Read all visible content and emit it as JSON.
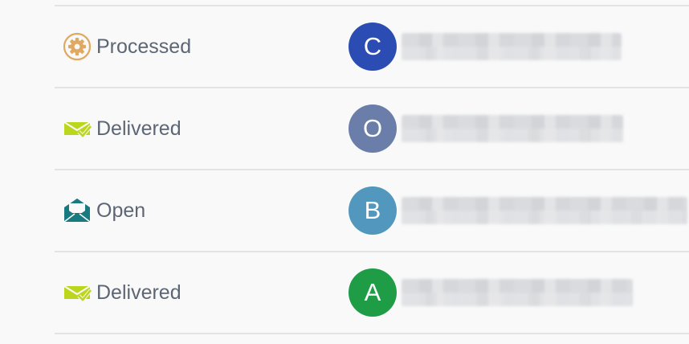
{
  "rows": [
    {
      "status": "Processed",
      "status_icon": "gear-icon",
      "avatar_letter": "C",
      "avatar_color": "#2b4db3"
    },
    {
      "status": "Delivered",
      "status_icon": "envelope-check-icon",
      "avatar_letter": "O",
      "avatar_color": "#6b7ea9"
    },
    {
      "status": "Open",
      "status_icon": "envelope-open-icon",
      "avatar_letter": "B",
      "avatar_color": "#5297be"
    },
    {
      "status": "Delivered",
      "status_icon": "envelope-check-icon",
      "avatar_letter": "A",
      "avatar_color": "#1f9c46"
    }
  ],
  "colors": {
    "processed_icon": "#e0a860",
    "delivered_icon": "#bcd61e",
    "open_icon": "#177a80",
    "text": "#5c6675"
  }
}
